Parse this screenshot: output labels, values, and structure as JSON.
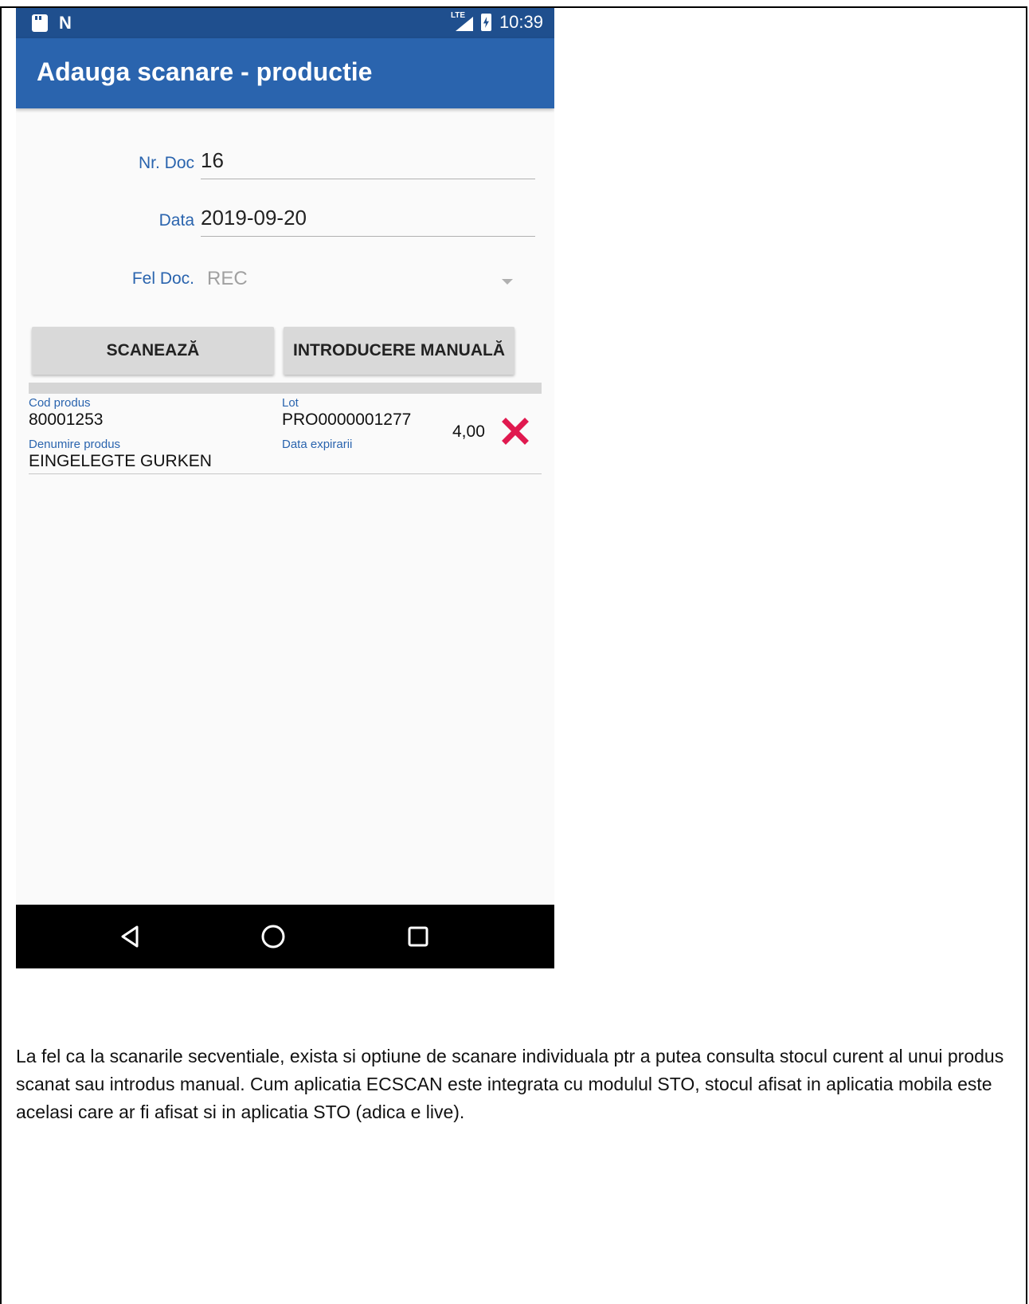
{
  "statusbar": {
    "time": "10:39",
    "network_label": "LTE",
    "icons": [
      "sd-card-icon",
      "nfc-n-icon",
      "lte-signal-icon",
      "battery-charging-icon"
    ]
  },
  "toolbar": {
    "title": "Adauga scanare - productie"
  },
  "form": {
    "nr_doc_label": "Nr. Doc",
    "nr_doc_value": "16",
    "data_label": "Data",
    "data_value": "2019-09-20",
    "fel_doc_label": "Fel Doc.",
    "fel_doc_value": "REC"
  },
  "buttons": {
    "scan_label": "SCANEAZĂ",
    "manual_label": "INTRODUCERE MANUALĂ"
  },
  "items": [
    {
      "cod_produs_caption": "Cod produs",
      "cod_produs": "80001253",
      "lot_caption": "Lot",
      "lot": "PRO0000001277",
      "denumire_caption": "Denumire produs",
      "denumire": "EINGELEGTE GURKEN",
      "data_expirarii_caption": "Data expirarii",
      "data_expirarii": "",
      "cantitate": "4,00"
    }
  ],
  "colors": {
    "statusbar": "#1f4f8e",
    "toolbar": "#2a64ae",
    "accent_label": "#2a64ae",
    "delete_icon": "#e0194f",
    "navbar": "#000000"
  },
  "navbar": {
    "icons": [
      "back-icon",
      "home-icon",
      "recents-icon"
    ]
  },
  "caption": {
    "text": "La fel ca la scanarile secventiale, exista si optiune de scanare individuala ptr a putea consulta stocul curent al unui produs scanat sau introdus manual. Cum aplicatia ECSCAN este integrata cu modulul STO, stocul afisat in aplicatia mobila este acelasi care ar fi afisat si in aplicatia STO (adica e live)."
  }
}
